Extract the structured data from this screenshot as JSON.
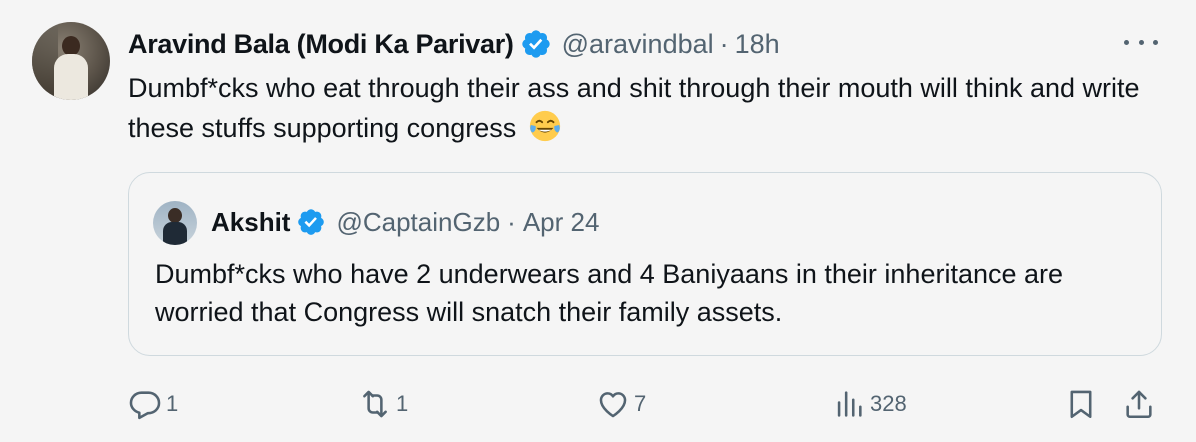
{
  "tweet": {
    "author_name": "Aravind Bala (Modi Ka Parivar)",
    "handle": "@aravindbal",
    "separator": "·",
    "time": "18h",
    "text": "Dumbf*cks who eat through their ass and shit through their mouth will think and write these stuffs supporting congress",
    "emoji": "face-with-tears-of-joy"
  },
  "quote": {
    "author_name": "Akshit",
    "handle": "@CaptainGzb",
    "separator": "·",
    "time": "Apr 24",
    "text": "Dumbf*cks who have 2 underwears and 4 Baniyaans in their inheritance are worried that Congress will snatch their family assets."
  },
  "actions": {
    "replies": "1",
    "retweets": "1",
    "likes": "7",
    "views": "328"
  },
  "colors": {
    "background": "#f5f5f5",
    "text": "#0f1419",
    "secondary": "#536471",
    "verified": "#1d9bf0",
    "border": "#cfd9de"
  }
}
